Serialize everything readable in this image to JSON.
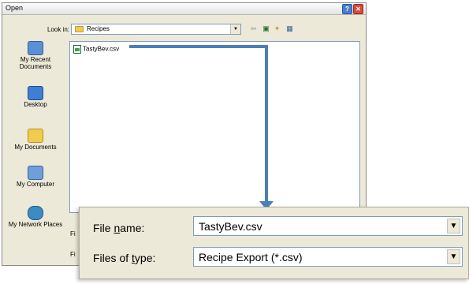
{
  "window": {
    "title": "Open",
    "help_glyph": "?",
    "close_glyph": "✕"
  },
  "lookin": {
    "label": "Look in:",
    "value": "Recipes",
    "arrow": "▼"
  },
  "toolbar": {
    "back_glyph": "⇦",
    "up_glyph": "▣",
    "newfolder_glyph": "✦",
    "views_glyph": "▦"
  },
  "places": [
    {
      "label": "My Recent Documents",
      "icon": "recent-documents-icon"
    },
    {
      "label": "Desktop",
      "icon": "desktop-icon"
    },
    {
      "label": "My Documents",
      "icon": "my-documents-icon"
    },
    {
      "label": "My Computer",
      "icon": "my-computer-icon"
    },
    {
      "label": "My Network Places",
      "icon": "network-places-icon"
    }
  ],
  "files": [
    {
      "name": "TastyBev.csv",
      "icon": "csv-file-icon"
    }
  ],
  "background_labels": {
    "file_name": "Fi",
    "file_type": "Fi"
  },
  "zoom": {
    "file_name_prefix": "File ",
    "file_name_ul": "n",
    "file_name_suffix": "ame:",
    "file_name_value": "TastyBev.csv",
    "file_type_prefix": "Files of ",
    "file_type_ul": "t",
    "file_type_suffix": "ype:",
    "file_type_value": "Recipe Export (*.csv)",
    "arrow": "▼"
  },
  "colors": {
    "connector": "#4b7fb8",
    "dialog_bg": "#ece9d8",
    "field_border": "#7f9db9"
  }
}
